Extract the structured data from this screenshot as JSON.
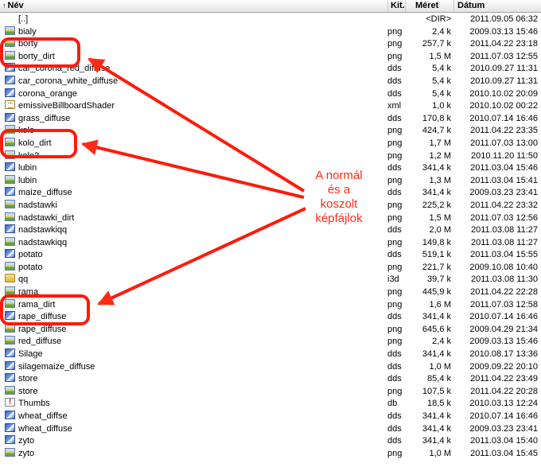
{
  "header": {
    "name_label": "Név",
    "ext_label": "Kit.",
    "size_label": "Méret",
    "date_label": "Dátum",
    "sort_indicator": "↑"
  },
  "files": [
    {
      "name": "[..]",
      "ext": "",
      "size": "<DIR>",
      "date": "2011.09.05 06:32",
      "icon": "dir"
    },
    {
      "name": "bialy",
      "ext": "png",
      "size": "2,4 k",
      "date": "2009.03.13 15:46",
      "icon": "png"
    },
    {
      "name": "borty",
      "ext": "png",
      "size": "257,7 k",
      "date": "2011.04.22 23:18",
      "icon": "png"
    },
    {
      "name": "borty_dirt",
      "ext": "png",
      "size": "1,5 M",
      "date": "2011.07.03 12:55",
      "icon": "png"
    },
    {
      "name": "car_corona_red_diffuse",
      "ext": "dds",
      "size": "5,4 k",
      "date": "2010.09.27 11:31",
      "icon": "dds"
    },
    {
      "name": "car_corona_white_diffuse",
      "ext": "dds",
      "size": "5,4 k",
      "date": "2010.09.27 11:31",
      "icon": "dds"
    },
    {
      "name": "corona_orange",
      "ext": "dds",
      "size": "5,4 k",
      "date": "2010.10.02 20:09",
      "icon": "dds"
    },
    {
      "name": "emissiveBillboardShader",
      "ext": "xml",
      "size": "1,0 k",
      "date": "2010.10.02 00:22",
      "icon": "xml"
    },
    {
      "name": "grass_diffuse",
      "ext": "dds",
      "size": "170,8 k",
      "date": "2010.07.14 16:46",
      "icon": "dds"
    },
    {
      "name": "kolo",
      "ext": "png",
      "size": "424,7 k",
      "date": "2011.04.22 23:35",
      "icon": "png"
    },
    {
      "name": "kolo_dirt",
      "ext": "png",
      "size": "1,7 M",
      "date": "2011.07.03 13:00",
      "icon": "png"
    },
    {
      "name": "kolo2",
      "ext": "png",
      "size": "1,2 M",
      "date": "2010.11.20 11:50",
      "icon": "png"
    },
    {
      "name": "lubin",
      "ext": "dds",
      "size": "341,4 k",
      "date": "2011.03.04 15:46",
      "icon": "dds"
    },
    {
      "name": "lubin",
      "ext": "png",
      "size": "1,3 M",
      "date": "2011.03.04 15:41",
      "icon": "png"
    },
    {
      "name": "maize_diffuse",
      "ext": "dds",
      "size": "341,4 k",
      "date": "2009.03.23 23:41",
      "icon": "dds"
    },
    {
      "name": "nadstawki",
      "ext": "png",
      "size": "225,2 k",
      "date": "2011.04.22 23:32",
      "icon": "png"
    },
    {
      "name": "nadstawki_dirt",
      "ext": "png",
      "size": "1,5 M",
      "date": "2011.07.03 12:56",
      "icon": "png"
    },
    {
      "name": "nadstawkiqq",
      "ext": "dds",
      "size": "2,0 M",
      "date": "2011.03.08 11:27",
      "icon": "dds"
    },
    {
      "name": "nadstawkiqq",
      "ext": "png",
      "size": "149,8 k",
      "date": "2011.03.08 11:27",
      "icon": "png"
    },
    {
      "name": "potato",
      "ext": "dds",
      "size": "519,1 k",
      "date": "2011.03.04 15:55",
      "icon": "dds"
    },
    {
      "name": "potato",
      "ext": "png",
      "size": "221,7 k",
      "date": "2009.10.08 10:40",
      "icon": "png"
    },
    {
      "name": "qq",
      "ext": "i3d",
      "size": "39,7 k",
      "date": "2011.03.08 11:30",
      "icon": "i3d"
    },
    {
      "name": "rama",
      "ext": "png",
      "size": "445,9 k",
      "date": "2011.04.22 22:28",
      "icon": "png"
    },
    {
      "name": "rama_dirt",
      "ext": "png",
      "size": "1,6 M",
      "date": "2011.07.03 12:58",
      "icon": "png"
    },
    {
      "name": "rape_diffuse",
      "ext": "dds",
      "size": "341,4 k",
      "date": "2010.07.14 16:46",
      "icon": "dds"
    },
    {
      "name": "rape_diffuse",
      "ext": "png",
      "size": "645,6 k",
      "date": "2009.04.29 21:34",
      "icon": "png"
    },
    {
      "name": "red_diffuse",
      "ext": "png",
      "size": "2,4 k",
      "date": "2009.03.13 15:46",
      "icon": "png"
    },
    {
      "name": "Silage",
      "ext": "dds",
      "size": "341,4 k",
      "date": "2010.08.17 13:36",
      "icon": "dds"
    },
    {
      "name": "silagemaize_diffuse",
      "ext": "dds",
      "size": "1,0 M",
      "date": "2009.09.22 20:10",
      "icon": "dds"
    },
    {
      "name": "store",
      "ext": "dds",
      "size": "85,4 k",
      "date": "2011.04.22 23:49",
      "icon": "dds"
    },
    {
      "name": "store",
      "ext": "png",
      "size": "107,5 k",
      "date": "2011.04.22 20:28",
      "icon": "png"
    },
    {
      "name": "Thumbs",
      "ext": "db",
      "size": "18,5 k",
      "date": "2010.03.13 12:24",
      "icon": "db"
    },
    {
      "name": "wheat_diffse",
      "ext": "dds",
      "size": "341,4 k",
      "date": "2010.07.14 16:46",
      "icon": "dds"
    },
    {
      "name": "wheat_diffuse",
      "ext": "dds",
      "size": "341,4 k",
      "date": "2009.03.23 23:41",
      "icon": "dds"
    },
    {
      "name": "zyto",
      "ext": "dds",
      "size": "341,4 k",
      "date": "2011.03.04 15:40",
      "icon": "dds"
    },
    {
      "name": "zyto",
      "ext": "png",
      "size": "1,0 M",
      "date": "2011.03.04 15:45",
      "icon": "png"
    }
  ],
  "annotation": {
    "lines": [
      "A normál",
      "és a",
      "koszolt",
      "képfájlok"
    ],
    "color": "#ff2b16"
  }
}
